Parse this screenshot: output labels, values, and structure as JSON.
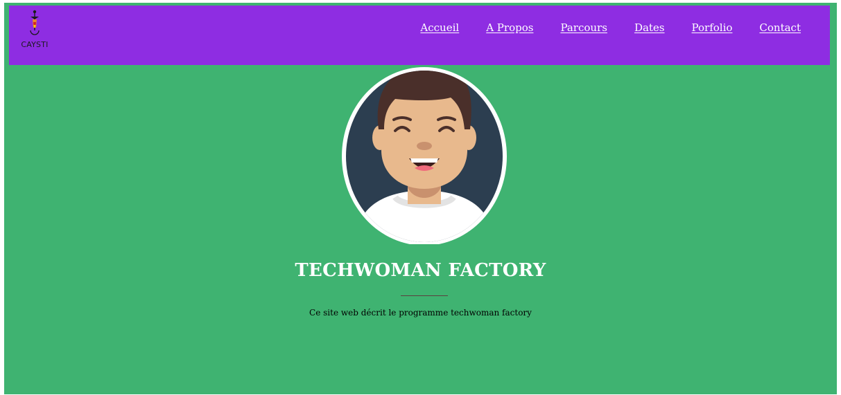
{
  "header": {
    "logo_text": "CAYSTI",
    "nav": [
      {
        "label": "Accueil"
      },
      {
        "label": "A Propos"
      },
      {
        "label": "Parcours"
      },
      {
        "label": "Dates"
      },
      {
        "label": "Porfolio"
      },
      {
        "label": "Contact"
      }
    ]
  },
  "hero": {
    "title": "TECHWOMAN FACTORY",
    "subtitle": "Ce site web décrit le programme techwoman factory"
  },
  "colors": {
    "page_background": "#3fb371",
    "navbar_background": "#8e2de2",
    "avatar_background": "#2c3e50"
  },
  "icons": {
    "logo": "caysti-logo-icon",
    "avatar": "smiling-man-avatar-icon"
  }
}
